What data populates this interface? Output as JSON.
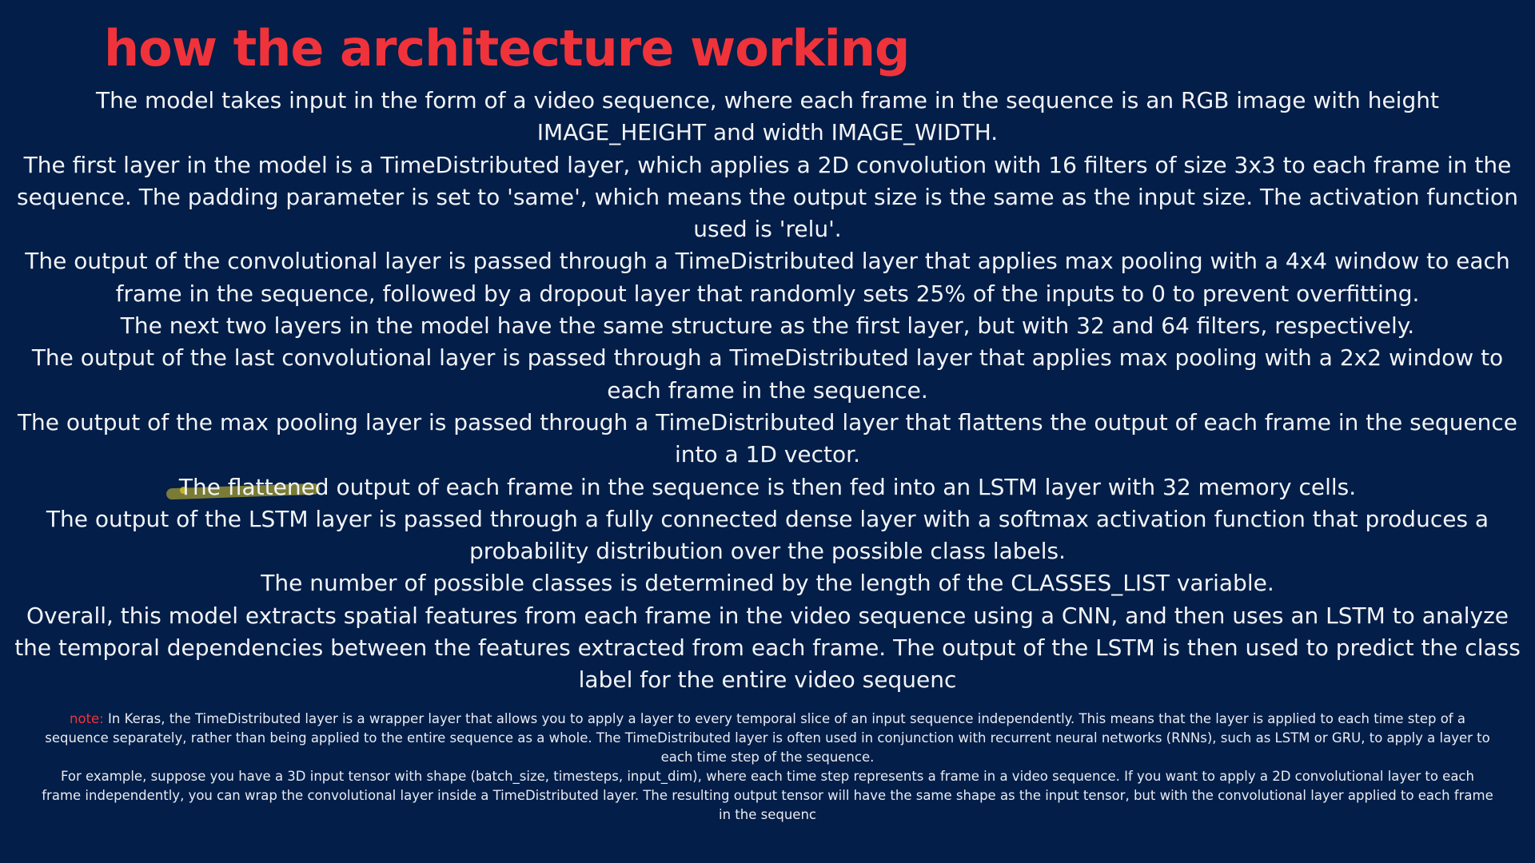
{
  "slide": {
    "title": "how the architecture working",
    "paragraphs": [
      "The model takes input in the form of a video sequence, where each frame in the sequence is an RGB image with height IMAGE_HEIGHT and width IMAGE_WIDTH.",
      "The first layer in the model is a TimeDistributed layer, which applies a 2D convolution with 16 filters of size 3x3 to each frame in the sequence. The padding parameter is set to 'same', which means the output size is the same as the input size. The activation function used is 'relu'.",
      "The output of the convolutional layer is passed through a TimeDistributed layer that applies max pooling with a 4x4 window to each frame in the sequence, followed by a dropout layer that randomly sets 25% of the inputs to 0 to prevent overfitting.",
      "The next two layers in the model have the same structure as the first layer, but with 32 and 64 filters, respectively.",
      "The output of the last convolutional layer is passed through a TimeDistributed layer that applies max pooling with a 2x2 window to each frame in the sequence.",
      "The output of the max pooling layer is passed through a TimeDistributed layer that flattens the output of each frame in the sequence into a 1D vector.",
      "The flattened output of each frame in the sequence is then fed into an LSTM layer with 32 memory cells.",
      "The output of the LSTM layer is passed through a fully connected dense layer with a softmax activation function that produces a probability distribution over the possible class labels.",
      "The number of possible classes is determined by the length of the CLASSES_LIST variable.",
      "Overall, this model extracts spatial features from each frame in the video sequence using a CNN, and then uses an LSTM to analyze the temporal dependencies between the features extracted from each frame. The output of the LSTM is then used to predict the class label for the entire video sequenc"
    ],
    "note": {
      "label": "note:",
      "text": " In Keras, the TimeDistributed layer is a wrapper layer that allows you to apply a layer to every temporal slice of an input sequence independently. This means that the layer is applied to each time step of a sequence separately, rather than being applied to the entire sequence as a whole. The TimeDistributed layer is often used in conjunction with recurrent neural networks (RNNs), such as LSTM or GRU, to apply a layer to each time step of the sequence.",
      "example": "For example, suppose you have a 3D input tensor with shape (batch_size, timesteps, input_dim), where each time step represents a frame in a video sequence. If you want to apply a 2D convolutional layer to each frame independently, you can wrap the convolutional layer inside a TimeDistributed layer. The resulting output tensor will have the same shape as the input tensor, but with the convolutional layer applied to each frame in the sequenc"
    },
    "colors": {
      "background": "#031e48",
      "title": "#f0333a",
      "text": "#f2f4f8",
      "highlight": "#dcc828"
    }
  }
}
